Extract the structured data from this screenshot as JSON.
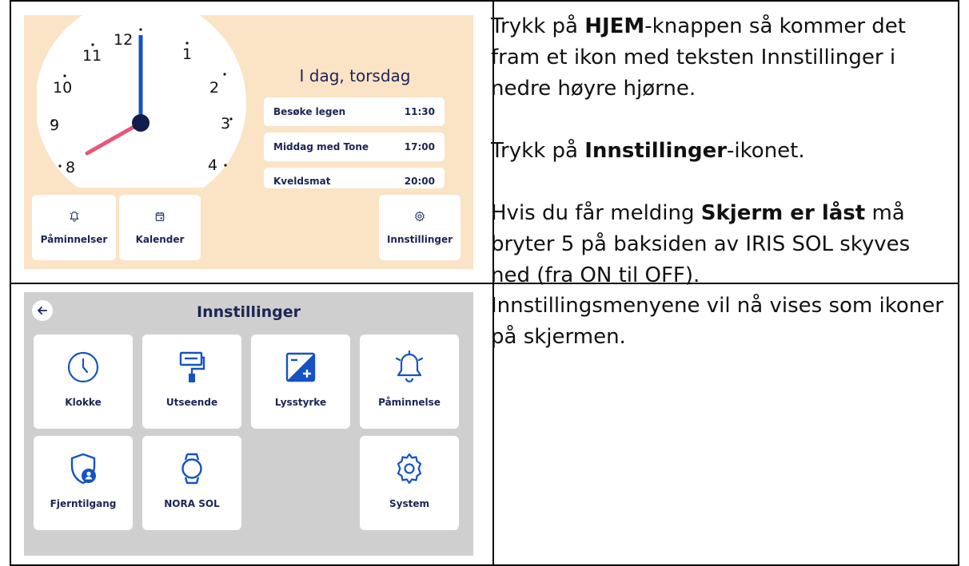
{
  "home_screen": {
    "clock": {
      "numbers": [
        "12",
        "1",
        "2",
        "3",
        "4",
        "8",
        "9",
        "10",
        "11"
      ]
    },
    "today_title": "I dag, torsdag",
    "events": [
      {
        "name": "Besøke legen",
        "time": "11:30"
      },
      {
        "name": "Middag med Tone",
        "time": "17:00"
      },
      {
        "name": "Kveldsmat",
        "time": "20:00"
      }
    ],
    "buttons": {
      "reminders": "Påminnelser",
      "calendar": "Kalender",
      "settings": "Innstillinger"
    },
    "colors": {
      "background": "#fbe3c6",
      "hour_hand": "#1553c2",
      "minute_hand": "#e8567a",
      "text": "#1b2454"
    }
  },
  "settings_screen": {
    "title": "Innstillinger",
    "tiles": [
      {
        "label": "Klokke",
        "icon": "clock-icon"
      },
      {
        "label": "Utseende",
        "icon": "paint-roller-icon"
      },
      {
        "label": "Lysstyrke",
        "icon": "brightness-icon"
      },
      {
        "label": "Påminnelse",
        "icon": "bell-icon"
      },
      {
        "label": "Fjerntilgang",
        "icon": "shield-user-icon"
      },
      {
        "label": "NORA SOL",
        "icon": "watch-icon"
      },
      {
        "label": "System",
        "icon": "gear-icon"
      }
    ],
    "colors": {
      "background": "#cfcfcf",
      "accent": "#1553c2"
    }
  },
  "instructions": {
    "row1": {
      "p1_before": "Trykk på ",
      "p1_bold": "HJEM",
      "p1_after": "-knappen så kommer det fram et ikon med teksten Innstillinger i nedre høyre hjørne.",
      "p2_before": "Trykk på ",
      "p2_bold": "Innstillinger",
      "p2_after": "-ikonet.",
      "p3_before": "Hvis du får melding ",
      "p3_bold": "Skjerm er låst",
      "p3_after": " må bryter 5 på baksiden av IRIS SOL skyves ned (fra ON til OFF)."
    },
    "row2": {
      "p1": "Innstillingsmenyene vil nå vises som ikoner på skjermen."
    }
  }
}
